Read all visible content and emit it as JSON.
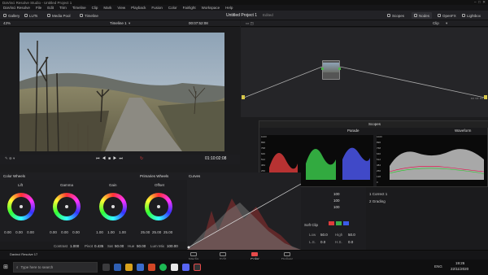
{
  "app": {
    "title": "DaVinci Resolve Studio - Untitled Project 1"
  },
  "menu": [
    "DaVinci Resolve",
    "File",
    "Edit",
    "Trim",
    "Timeline",
    "Clip",
    "Mark",
    "View",
    "Playback",
    "Fusion",
    "Color",
    "Fairlight",
    "Workspace",
    "Help"
  ],
  "toolbar": {
    "gallery": "Gallery",
    "luts": "LUTs",
    "media_pool": "Media Pool",
    "timeline": "Timeline",
    "project_title": "Untitled Project 1",
    "project_status": "Edited",
    "scopes": "Scopes",
    "nodes": "Nodes",
    "openfx": "OpenFX",
    "lightbox": "Lightbox"
  },
  "viewer": {
    "zoom": "43%",
    "timeline_name": "Timeline 1",
    "timecode_top": "00:07:52:08",
    "timecode": "01:10:02:08",
    "clip_label": "Clip"
  },
  "scopes": {
    "title": "Scopes",
    "left_mode": "Parade",
    "right_mode": "Waveform",
    "scale": [
      "1023",
      "896",
      "768",
      "640",
      "512",
      "384",
      "256",
      "128",
      "0"
    ]
  },
  "color_wheels": {
    "title": "Color Wheels",
    "wheels": [
      {
        "label": "Lift",
        "values": [
          "0.00",
          "0.00",
          "0.00",
          "0.00"
        ]
      },
      {
        "label": "Gamma",
        "values": [
          "0.00",
          "0.00",
          "0.00",
          "0.00"
        ]
      },
      {
        "label": "Gain",
        "values": [
          "1.00",
          "1.00",
          "1.00",
          "1.00"
        ]
      },
      {
        "label": "Offset",
        "values": [
          "25.00",
          "25.00",
          "25.00",
          "25.00"
        ]
      }
    ],
    "contrast_label": "Contrast",
    "contrast_value": "1.000",
    "pivot_label": "Pivot",
    "pivot_value": "0.435",
    "sat_label": "Sat",
    "sat_value": "50.00",
    "hue_label": "Hue",
    "hue_value": "50.00",
    "lum_mix_label": "Lum Mix",
    "lum_mix_value": "100.00"
  },
  "curves": {
    "title": "Curves",
    "mode": "Primaries Wheels"
  },
  "rgb_mixer": {
    "values": [
      "100",
      "100",
      "100"
    ],
    "soft_clip_label": "Soft Clip",
    "low_label": "Low",
    "low_value": "50.0",
    "high_label": "High",
    "high_value": "50.0",
    "ls_label": "L.S.",
    "ls_value": "0.0",
    "hs_label": "H.S.",
    "hs_value": "0.0"
  },
  "node_list": {
    "items": [
      "1 Correct 1",
      "2 Grading"
    ]
  },
  "page_tabs": [
    {
      "label": "Media",
      "active": false
    },
    {
      "label": "Edit",
      "active": false
    },
    {
      "label": "Color",
      "active": true
    },
    {
      "label": "Deliver",
      "active": false
    }
  ],
  "taskbar": {
    "search_placeholder": "Type here to search",
    "lang": "ENG",
    "time": "19:26",
    "date": "22/11/2020"
  },
  "app_status": "Davinci Resolve 17"
}
